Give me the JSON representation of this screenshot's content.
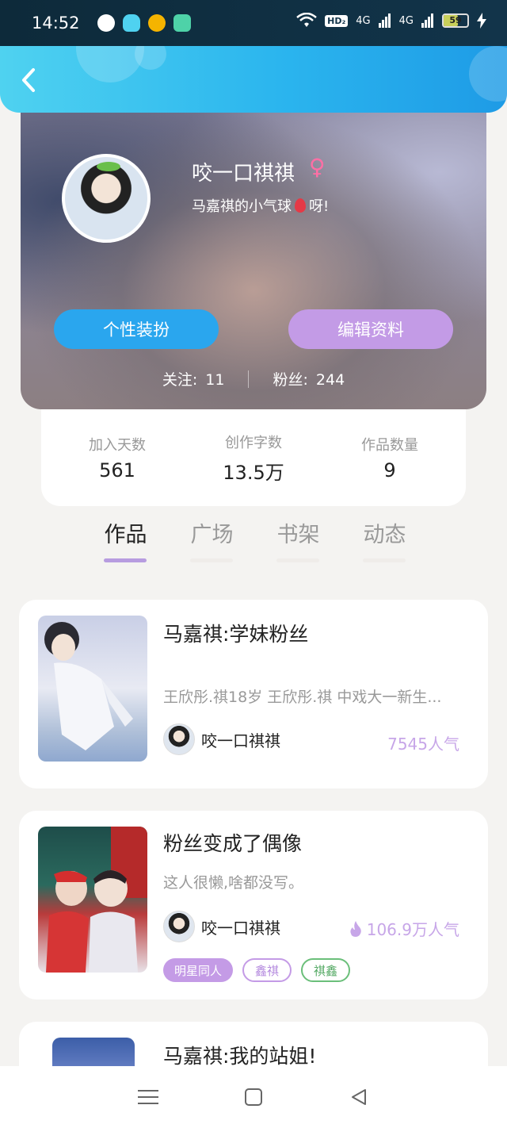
{
  "status_bar": {
    "time": "14:52",
    "hd_badge": "HD₂",
    "network_1": "4G",
    "network_2": "4G",
    "battery": "59"
  },
  "header": {
    "back_icon": "chevron-left-icon"
  },
  "profile": {
    "nickname": "咬一口祺祺",
    "gender_symbol": "♀",
    "bio_before": "马嘉祺的小气球",
    "bio_after": "呀!",
    "style_button": "个性装扮",
    "edit_button": "编辑资料",
    "following_label": "关注:",
    "following_count": "11",
    "followers_label": "粉丝:",
    "followers_count": "244"
  },
  "stats": [
    {
      "label": "加入天数",
      "value": "561"
    },
    {
      "label": "创作字数",
      "value": "13.5万"
    },
    {
      "label": "作品数量",
      "value": "9"
    }
  ],
  "tabs": [
    {
      "label": "作品",
      "active": true
    },
    {
      "label": "广场",
      "active": false
    },
    {
      "label": "书架",
      "active": false
    },
    {
      "label": "动态",
      "active": false
    }
  ],
  "works": [
    {
      "title": "马嘉祺:学妹粉丝",
      "description": "王欣彤.祺18岁 王欣彤.祺 中戏大一新生...",
      "author": "咬一口祺祺",
      "popularity": "7545人气"
    },
    {
      "title": "粉丝变成了偶像",
      "description": "这人很懒,啥都没写。",
      "author": "咬一口祺祺",
      "popularity": "106.9万人气",
      "tags": [
        "明星同人",
        "鑫祺",
        "祺鑫"
      ]
    },
    {
      "title": "马嘉祺:我的站姐!"
    }
  ],
  "colors": {
    "header_blue": "#2bb5ee",
    "style_button": "#2aa6ee",
    "edit_button": "#c39be6",
    "tab_indicator": "#b79ce0",
    "popularity": "#c7a6e8"
  }
}
